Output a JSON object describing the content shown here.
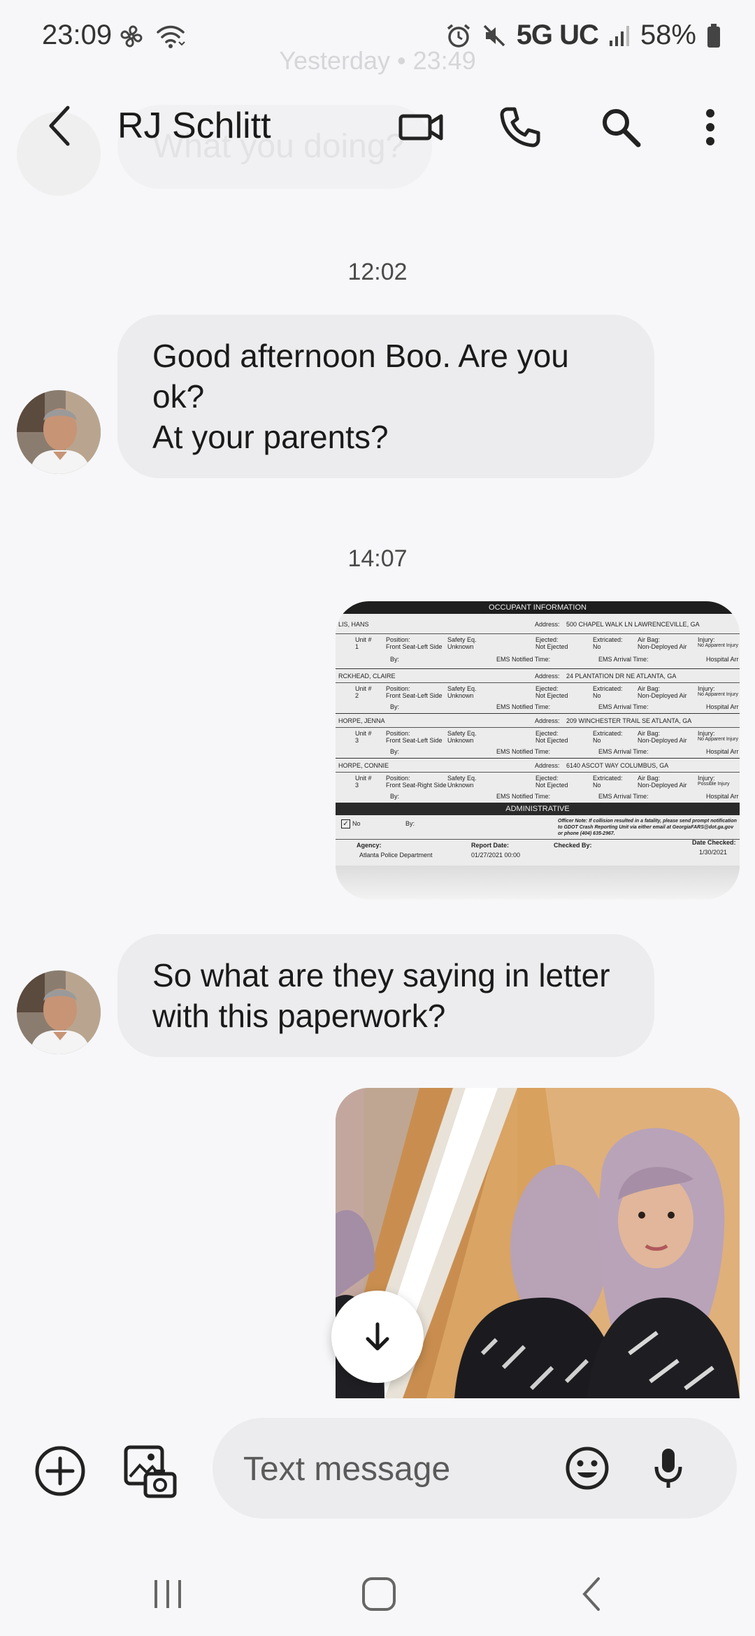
{
  "status_bar": {
    "time": "23:09",
    "network": "5G UC",
    "battery": "58%"
  },
  "background": {
    "date_divider": "Yesterday • 23:49",
    "message": "What you doing?"
  },
  "header": {
    "contact_name": "RJ Schlitt",
    "icons": [
      "back-icon",
      "video-call-icon",
      "phone-icon",
      "search-icon",
      "more-vert-icon"
    ]
  },
  "conversation": {
    "timestamp_1": "12:02",
    "message_1": "Good afternoon Boo. Are you ok?\nAt your parents?",
    "timestamp_2": "14:07",
    "message_2": "So what are they saying in letter with this paperwork?"
  },
  "document_image": {
    "header": "OCCUPANT INFORMATION",
    "rows": [
      {
        "name": "LIS, HANS",
        "unit": "1",
        "position": "Front Seat-Left Side",
        "address": "500 CHAPEL WALK LN LAWRENCEVILLE, GA",
        "ejected": "Not Ejected",
        "extricated": "No",
        "air_bag": "Non-Deployed Air",
        "injury": "No Apparent Injury"
      },
      {
        "name": "RCKHEAD, CLAIRE",
        "unit": "2",
        "position": "Front Seat-Left Side",
        "address": "24 PLANTATION DR NE ATLANTA, GA",
        "ejected": "Not Ejected",
        "extricated": "No",
        "air_bag": "Non-Deployed Air",
        "injury": "No Apparent Injury"
      },
      {
        "name": "HORPE, JENNA",
        "unit": "3",
        "position": "Front Seat-Left Side",
        "address": "209 WINCHESTER TRAIL SE ATLANTA, GA",
        "ejected": "Not Ejected",
        "extricated": "No",
        "air_bag": "Non-Deployed Air",
        "injury": "No Apparent Injury"
      },
      {
        "name": "HORPE, CONNIE",
        "unit": "3",
        "position": "Front Seat-Right Side",
        "address": "6140 ASCOT WAY COLUMBUS, GA",
        "ejected": "Not Ejected",
        "extricated": "No",
        "air_bag": "Non-Deployed Air",
        "injury": "Possible Injury"
      }
    ],
    "labels": {
      "unit": "Unit #",
      "position": "Position:",
      "safety": "Safety Eq.",
      "safety_value": "Unknown",
      "ejected": "Ejected:",
      "extricated": "Extricated:",
      "air_bag": "Air Bag:",
      "injury": "Injury:",
      "address": "Address:",
      "by": "By:",
      "ems_notified": "EMS Notified Time:",
      "ems_arrival": "EMS Arrival Time:",
      "hospital": "Hospital Arr"
    },
    "admin_header": "ADMINISTRATIVE",
    "checkbox_label": "No",
    "officer_note": "Officer Note: If collision resulted in a fatality, please send prompt notification to GDOT Crash Reporting Unit via either email at GeorgiaFARS@dot.ga.gov or phone (404) 635-2967.",
    "agency_label": "Agency:",
    "agency_value": "Atlanta Police Department",
    "report_date_label": "Report Date:",
    "report_date_value": "01/27/2021 00:00",
    "checked_by_label": "Checked By:",
    "date_checked_label": "Date Checked:",
    "date_checked_value": "1/30/2021"
  },
  "composer": {
    "placeholder": "Text message",
    "icons": [
      "add-icon",
      "gallery-camera-icon",
      "emoji-icon",
      "mic-icon"
    ]
  },
  "nav_bar": {
    "icons": [
      "recents-icon",
      "home-icon",
      "back-nav-icon"
    ]
  },
  "colors": {
    "background": "#f7f7f9",
    "incoming_bubble": "#ececee",
    "text": "#1a1a1a",
    "timestamp": "#4a4a4a"
  }
}
